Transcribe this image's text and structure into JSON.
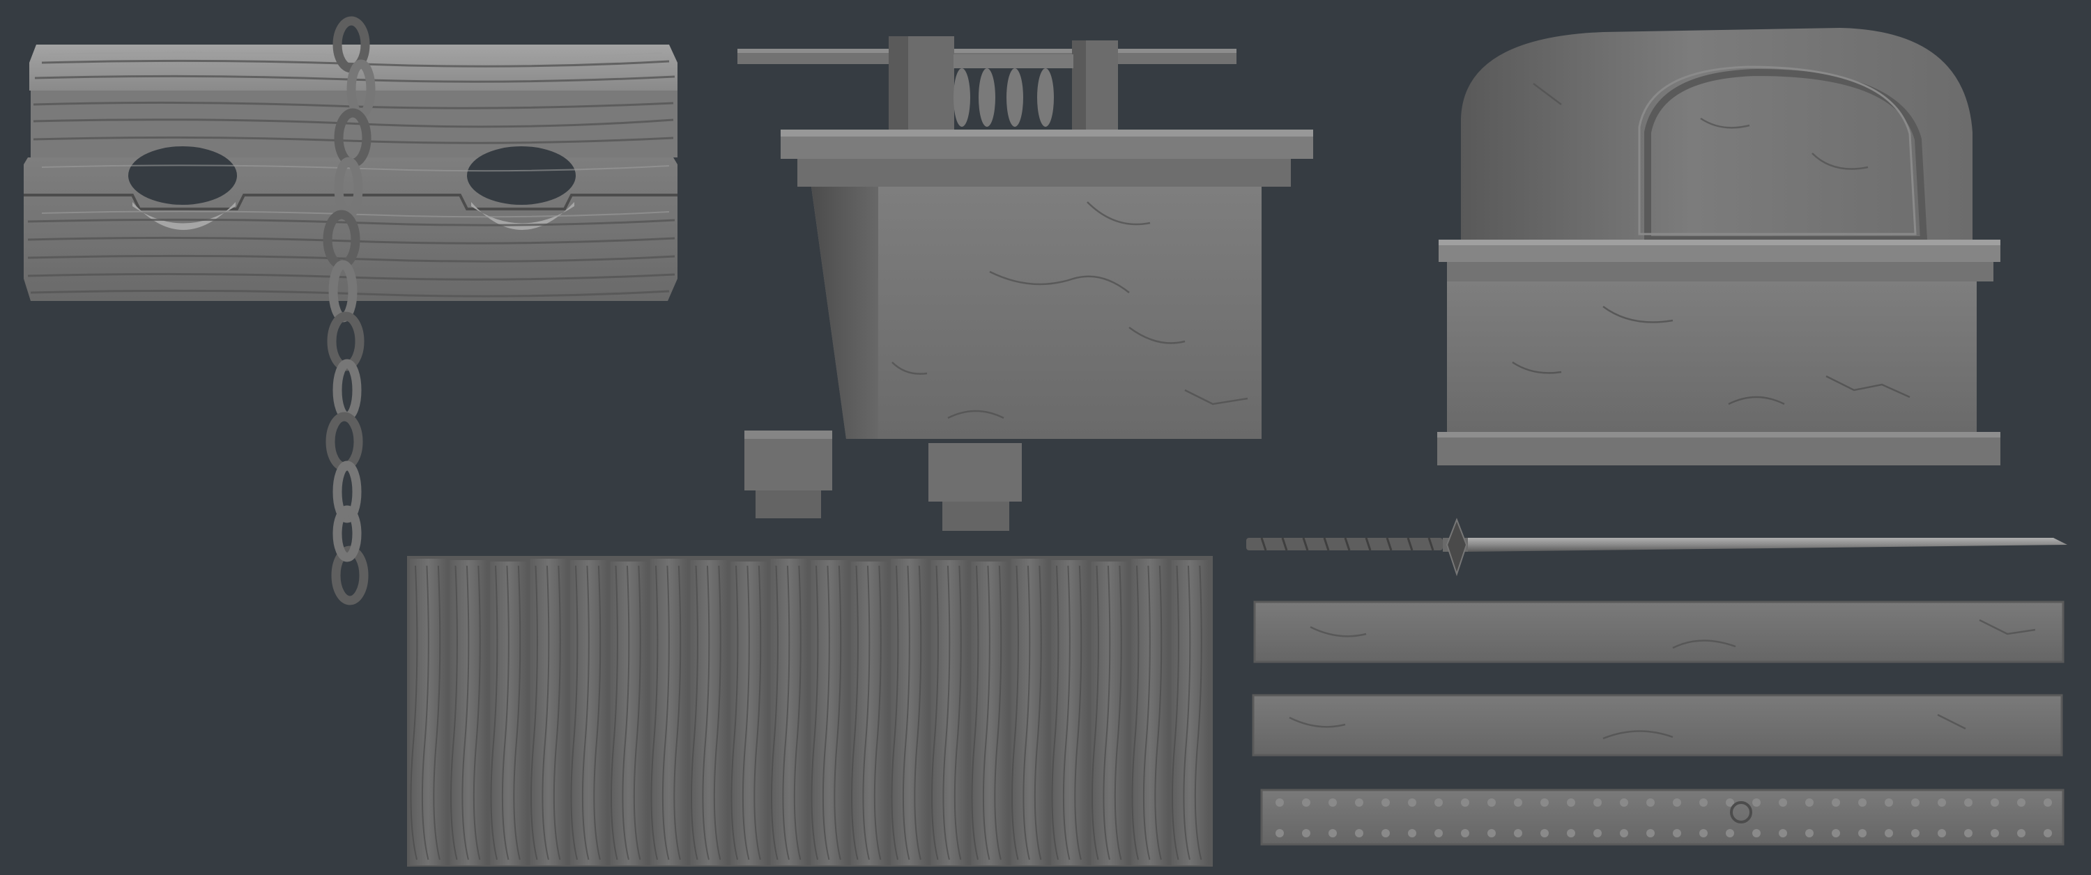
{
  "scene": {
    "background_color": "#363c42",
    "material_base_color": "#6f6f6f",
    "material_light_color": "#9a9a9a",
    "material_dark_color": "#3f3f3f",
    "objects": [
      {
        "name": "wooden-pillory-stocks",
        "icon": "pillory-icon"
      },
      {
        "name": "iron-chain",
        "icon": "chain-icon"
      },
      {
        "name": "stone-well-basin",
        "icon": "basin-icon"
      },
      {
        "name": "stone-shrine-arch",
        "icon": "shrine-icon"
      },
      {
        "name": "small-stone-block",
        "icon": "block-icon"
      },
      {
        "name": "wooden-plank-panel",
        "icon": "planks-icon"
      },
      {
        "name": "sword",
        "icon": "sword-icon"
      },
      {
        "name": "stone-beam-top",
        "icon": "beam-icon"
      },
      {
        "name": "stone-beam-middle",
        "icon": "beam-icon"
      },
      {
        "name": "riveted-stone-beam",
        "icon": "riveted-beam-icon"
      }
    ]
  }
}
